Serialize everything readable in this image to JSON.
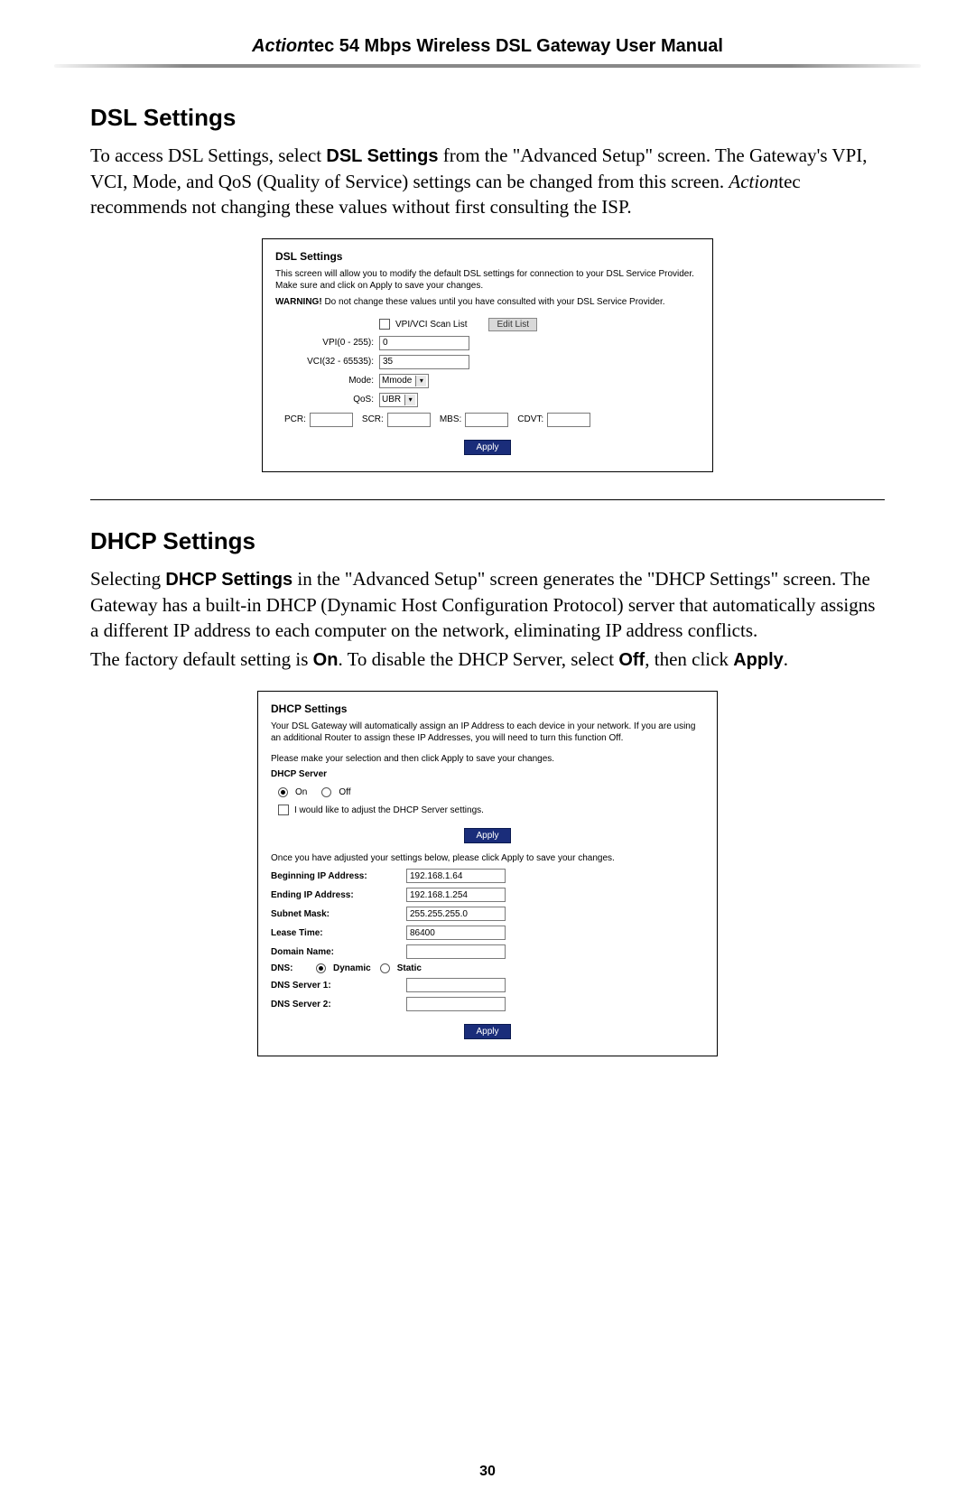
{
  "header": {
    "brand_italic": "Action",
    "brand_rest": "tec 54 Mbps Wireless DSL Gateway User Manual"
  },
  "dsl": {
    "heading": "DSL Settings",
    "intro_a": "To access DSL Settings, select ",
    "intro_b_bold": "DSL Settings",
    "intro_c": " from the \"Advanced Setup\" screen. The Gateway's VPI, VCI, Mode, and QoS (Quality of Service) settings can be changed from this screen. ",
    "intro_d_italic": "Action",
    "intro_e": "tec recommends not changing these values without first consulting the ISP.",
    "ss": {
      "title": "DSL Settings",
      "desc": "This screen will allow you to modify the default DSL settings for connection to your DSL Service Provider. Make sure and click on Apply to save your changes.",
      "warning_label": "WARNING!",
      "warning_text": " Do not change these values until you have consulted with your DSL Service Provider.",
      "scanlist_label": "VPI/VCI Scan List",
      "editlist_btn": "Edit List",
      "vpi_label": "VPI(0 - 255):",
      "vpi_value": "0",
      "vci_label": "VCI(32 - 65535):",
      "vci_value": "35",
      "mode_label": "Mode:",
      "mode_value": "Mmode",
      "qos_label": "QoS:",
      "qos_value": "UBR",
      "pcr_label": "PCR:",
      "scr_label": "SCR:",
      "mbs_label": "MBS:",
      "cdvt_label": "CDVT:",
      "apply": "Apply"
    }
  },
  "dhcp": {
    "heading": "DHCP Settings",
    "p1_a": "Selecting ",
    "p1_b_bold": "DHCP Settings",
    "p1_c": " in the \"Advanced Setup\" screen generates the \"DHCP Settings\" screen. The Gateway has a built-in DHCP (Dynamic Host Configuration Protocol) server that automatically assigns a different IP address to each computer on the network, eliminating IP address conflicts.",
    "p2_a": "The factory default setting is ",
    "p2_b_bold": "On",
    "p2_c": ". To disable the DHCP Server, select ",
    "p2_d_bold": "Off",
    "p2_e": ", then click ",
    "p2_f_bold": "Apply",
    "p2_g": ".",
    "ss": {
      "title": "DHCP Settings",
      "desc": "Your DSL Gateway will automatically assign an IP Address to each device in your network. If you are using an additional Router to assign these IP Addresses, you will need to turn this function Off.",
      "instruction": "Please make your selection and then click Apply to save your changes.",
      "server_label": "DHCP Server",
      "on_label": "On",
      "off_label": "Off",
      "adjust_label": "I would like to adjust the DHCP Server settings.",
      "apply1": "Apply",
      "adjusted_note": "Once you have adjusted your settings below, please click Apply to save your changes.",
      "begin_ip_label": "Beginning IP Address:",
      "begin_ip_value": "192.168.1.64",
      "end_ip_label": "Ending IP Address:",
      "end_ip_value": "192.168.1.254",
      "subnet_label": "Subnet Mask:",
      "subnet_value": "255.255.255.0",
      "lease_label": "Lease Time:",
      "lease_value": "86400",
      "domain_label": "Domain Name:",
      "domain_value": "",
      "dns_label": "DNS:",
      "dns_dynamic": "Dynamic",
      "dns_static": "Static",
      "dns1_label": "DNS Server 1:",
      "dns2_label": "DNS Server 2:",
      "apply2": "Apply"
    }
  },
  "page_number": "30"
}
